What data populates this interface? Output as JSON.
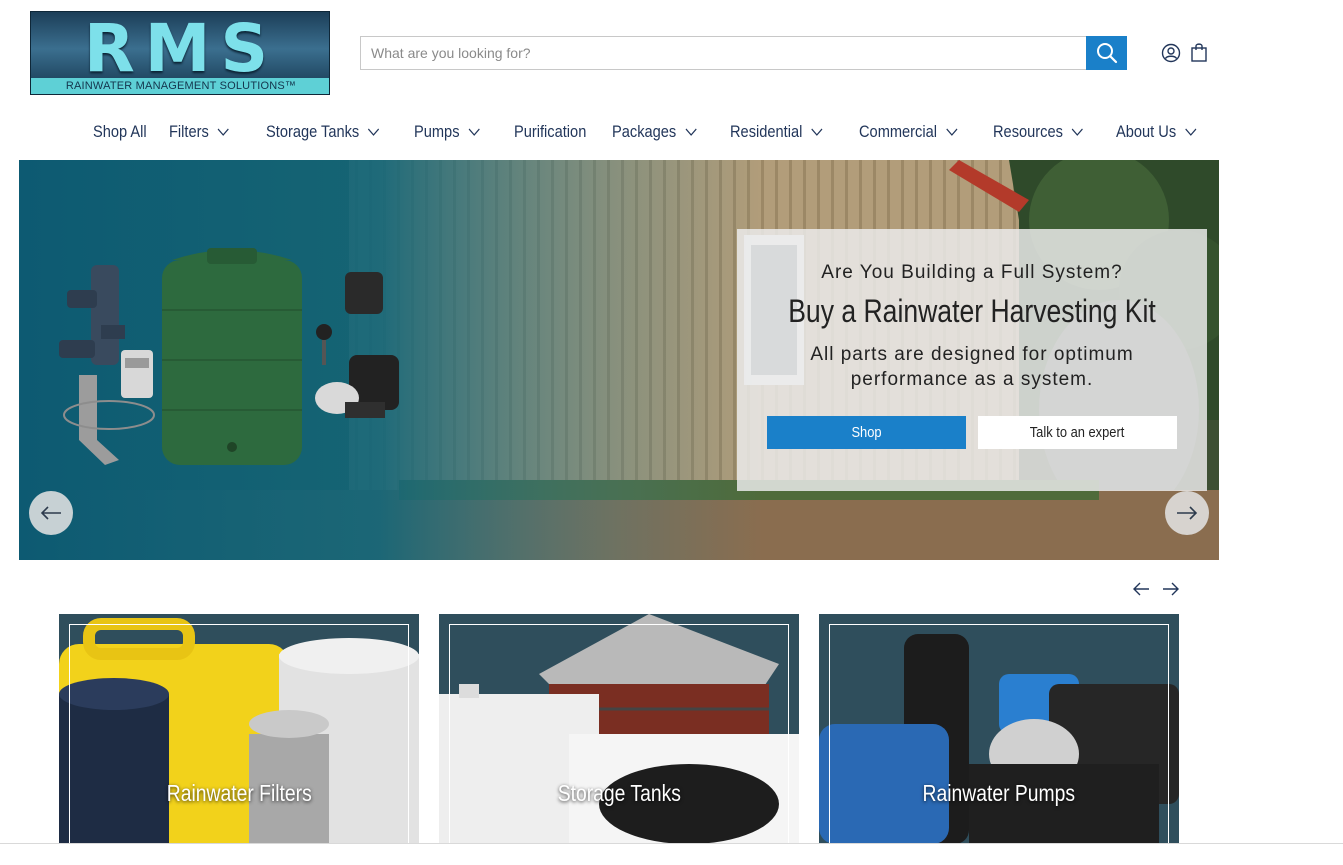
{
  "logo": {
    "letters": "RMS",
    "tagline": "RAINWATER MANAGEMENT SOLUTIONS™"
  },
  "search": {
    "placeholder": "What are you looking for?",
    "value": ""
  },
  "header_icons": [
    "search-icon",
    "account-icon",
    "cart-icon"
  ],
  "nav": {
    "items": [
      {
        "label": "Shop All",
        "has_dropdown": false
      },
      {
        "label": "Filters",
        "has_dropdown": true
      },
      {
        "label": "Storage Tanks",
        "has_dropdown": true
      },
      {
        "label": "Pumps",
        "has_dropdown": true
      },
      {
        "label": "Purification",
        "has_dropdown": false
      },
      {
        "label": "Packages",
        "has_dropdown": true
      },
      {
        "label": "Residential",
        "has_dropdown": true
      },
      {
        "label": "Commercial",
        "has_dropdown": true
      },
      {
        "label": "Resources",
        "has_dropdown": true
      },
      {
        "label": "About Us",
        "has_dropdown": true
      }
    ]
  },
  "hero": {
    "pretitle": "Are You Building a Full System?",
    "title": "Buy a Rainwater Harvesting Kit",
    "text": "All parts are designed for optimum performance as a system.",
    "primary_button": "Shop",
    "secondary_button": "Talk to an expert"
  },
  "categories": [
    {
      "label": "Rainwater Filters"
    },
    {
      "label": "Storage Tanks"
    },
    {
      "label": "Rainwater Pumps"
    }
  ],
  "colors": {
    "accent_blue": "#1a80c9",
    "nav_text": "#22365a",
    "logo_teal": "#5ed0d6"
  }
}
